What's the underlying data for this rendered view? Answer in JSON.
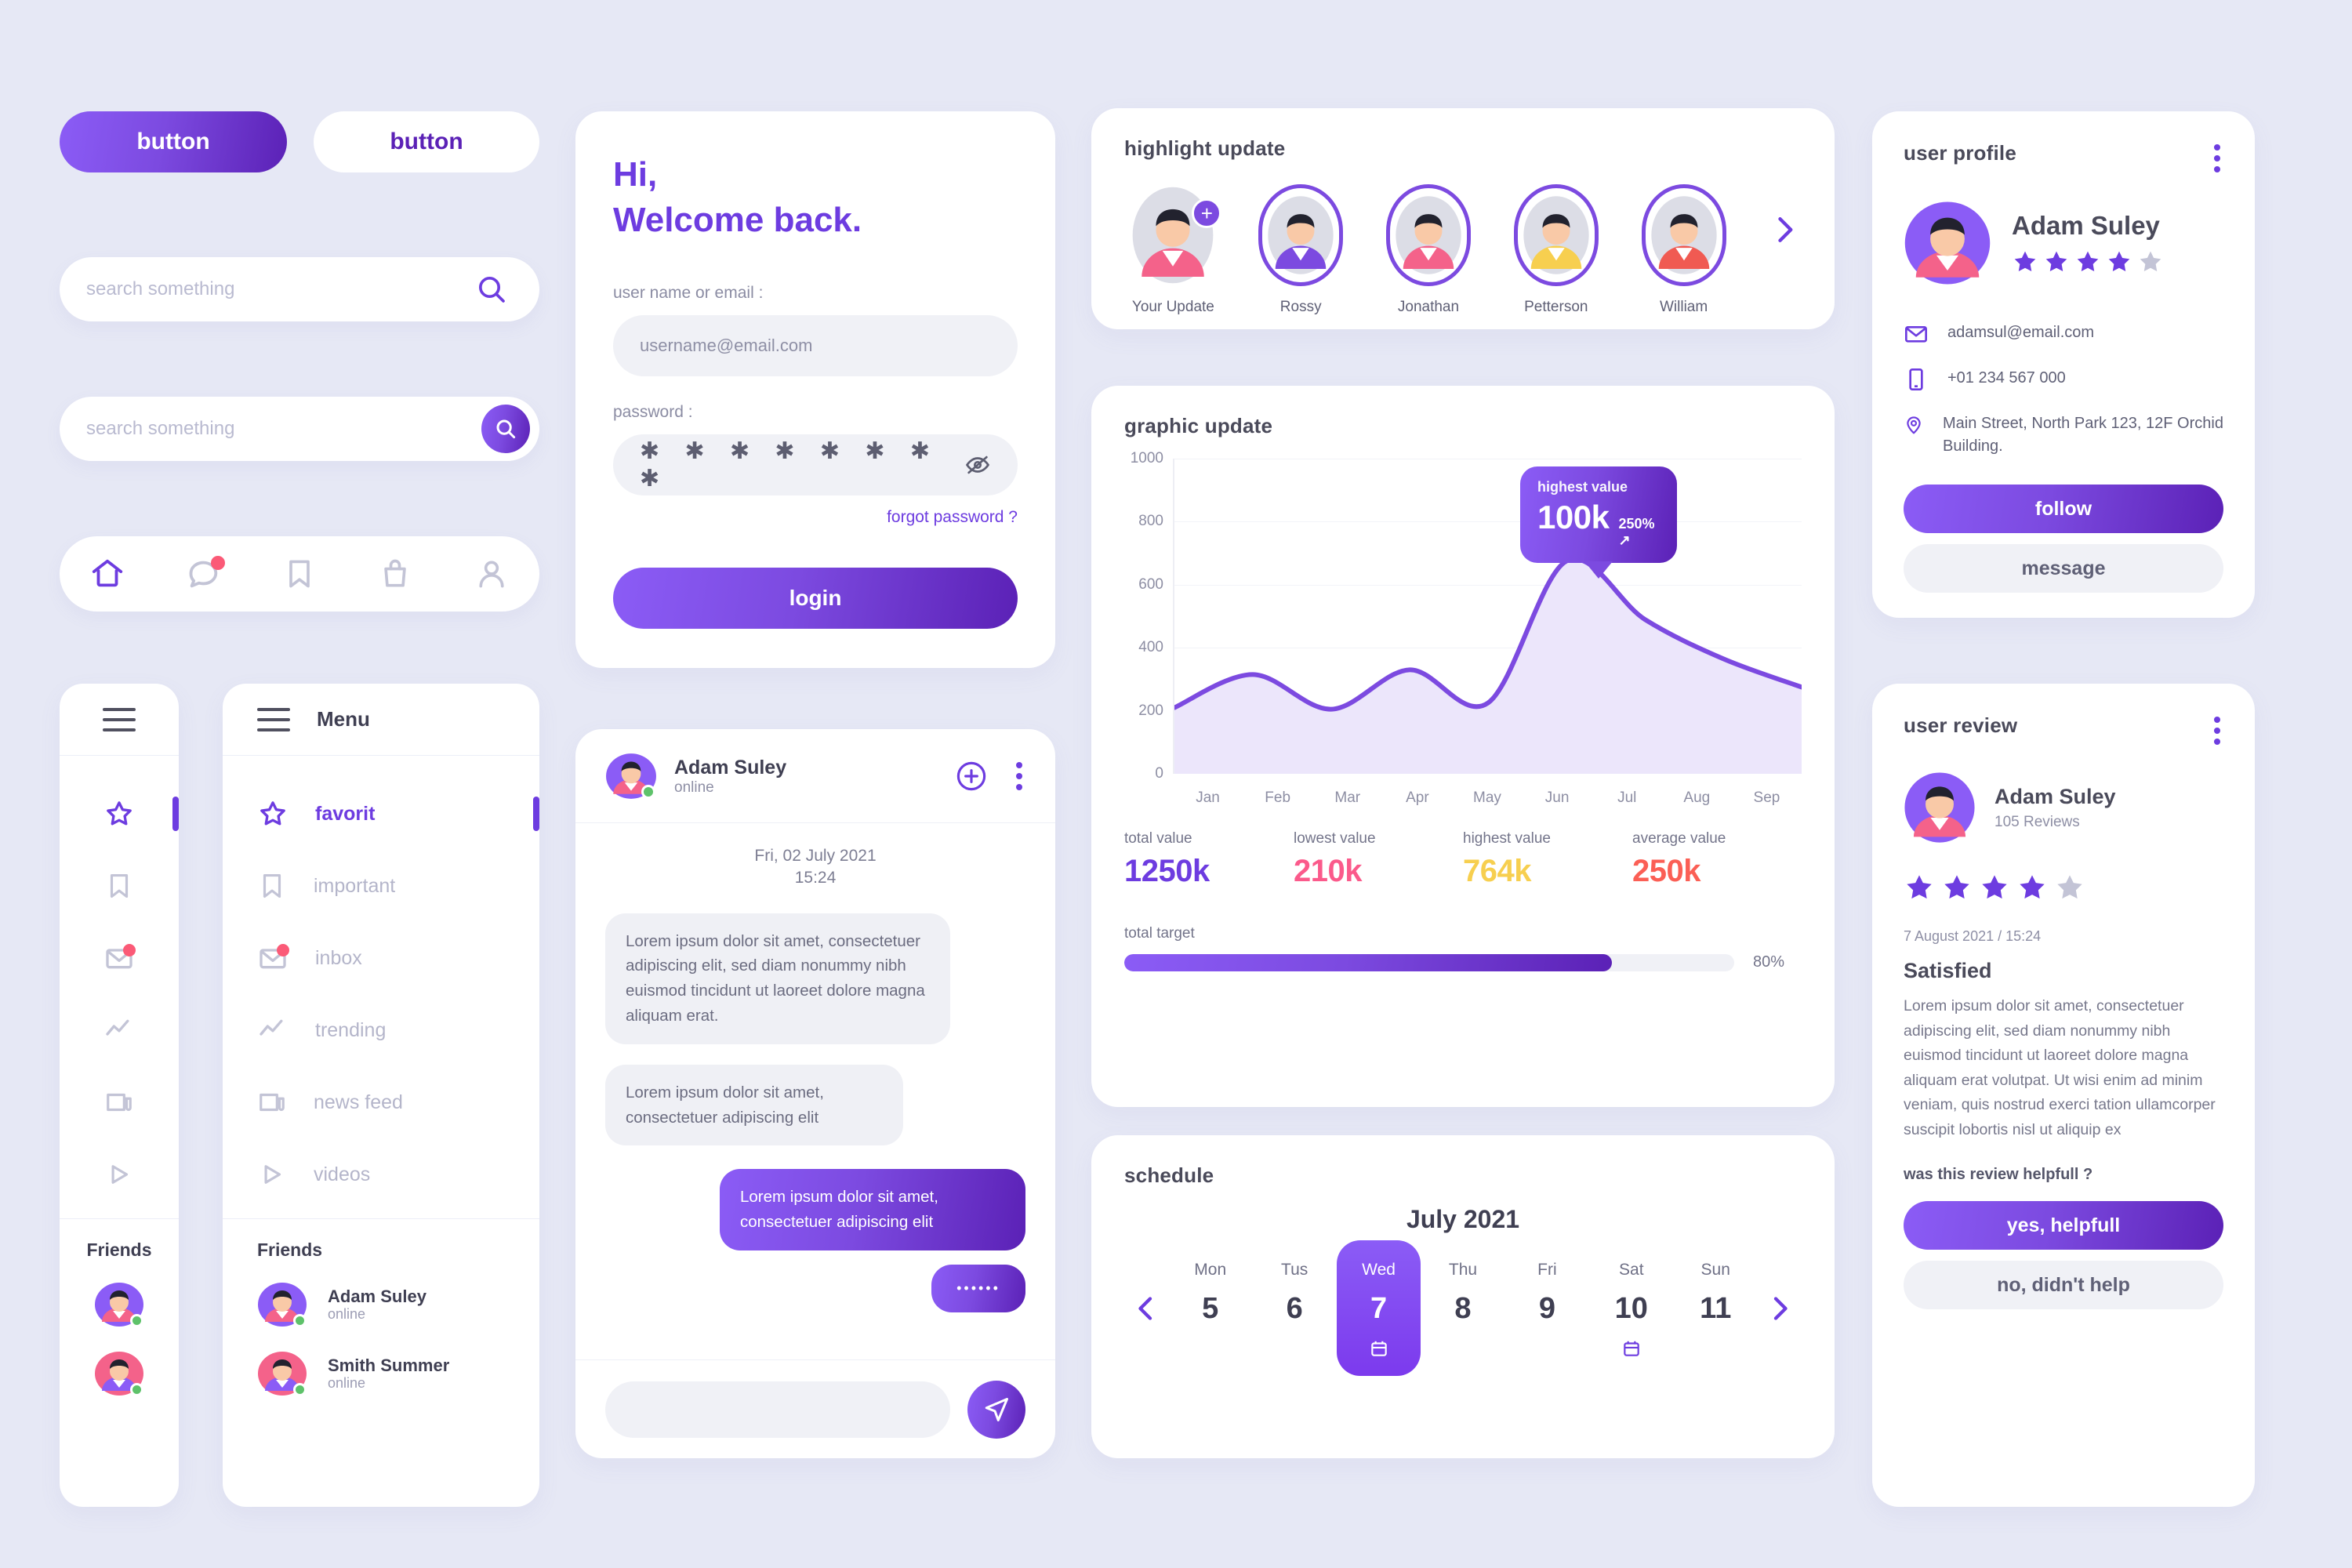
{
  "buttons": {
    "primary_label": "button",
    "secondary_label": "button"
  },
  "search": {
    "plain_placeholder": "search something",
    "round_placeholder": "search something",
    "icon": "search-icon"
  },
  "bottom_nav": {
    "items": [
      {
        "name": "home-icon",
        "active": true,
        "badge": false
      },
      {
        "name": "chat-icon",
        "active": false,
        "badge": true
      },
      {
        "name": "bookmark-icon",
        "active": false,
        "badge": false
      },
      {
        "name": "bag-icon",
        "active": false,
        "badge": false
      },
      {
        "name": "user-icon",
        "active": false,
        "badge": false
      }
    ]
  },
  "sidebar": {
    "title": "Menu",
    "items": [
      {
        "label": "favorit",
        "icon": "star-icon",
        "active": true,
        "badge": false
      },
      {
        "label": "important",
        "icon": "bookmark-icon",
        "active": false,
        "badge": false
      },
      {
        "label": "inbox",
        "icon": "mail-icon",
        "active": false,
        "badge": true
      },
      {
        "label": "trending",
        "icon": "trending-icon",
        "active": false,
        "badge": false
      },
      {
        "label": "news feed",
        "icon": "news-icon",
        "active": false,
        "badge": false
      },
      {
        "label": "videos",
        "icon": "play-icon",
        "active": false,
        "badge": false
      }
    ],
    "friends_title": "Friends",
    "friends": [
      {
        "name": "Adam Suley",
        "status": "online",
        "color": "#8b5cf6"
      },
      {
        "name": "Smith Summer",
        "status": "online",
        "color": "#f4628a"
      }
    ]
  },
  "login": {
    "greeting_line1": "Hi,",
    "greeting_line2": "Welcome back.",
    "username_label": "user name or email :",
    "username_placeholder": "username@email.com",
    "password_label": "password :",
    "password_mask": "✱ ✱ ✱ ✱ ✱ ✱ ✱ ✱",
    "toggle_icon": "eye-off-icon",
    "forgot_label": "forgot password ?",
    "login_label": "login"
  },
  "chat": {
    "contact_name": "Adam Suley",
    "contact_status": "online",
    "add_icon": "plus-circle-icon",
    "menu_icon": "kebab-icon",
    "date_line1": "Fri, 02 July 2021",
    "date_line2": "15:24",
    "messages": [
      {
        "side": "in",
        "text": "Lorem ipsum dolor sit amet, consectetuer adipiscing elit, sed diam nonummy nibh euismod tincidunt ut laoreet dolore magna aliquam erat."
      },
      {
        "side": "in",
        "text": "Lorem ipsum dolor sit amet, consectetuer adipiscing elit"
      },
      {
        "side": "out",
        "text": "Lorem ipsum dolor sit amet, consectetuer adipiscing elit"
      },
      {
        "side": "typing",
        "text": "••••••"
      }
    ],
    "input_placeholder": "",
    "send_icon": "send-icon"
  },
  "highlight": {
    "title": "highlight update",
    "next_icon": "chevron-right-icon",
    "stories": [
      {
        "label": "Your Update",
        "ringed": false,
        "plus": true,
        "shirt": "#f4628a"
      },
      {
        "label": "Rossy",
        "ringed": true,
        "plus": false,
        "shirt": "#7c4ae0"
      },
      {
        "label": "Jonathan",
        "ringed": true,
        "plus": false,
        "shirt": "#f4628a"
      },
      {
        "label": "Petterson",
        "ringed": true,
        "plus": false,
        "shirt": "#f7cf4f"
      },
      {
        "label": "William",
        "ringed": true,
        "plus": false,
        "shirt": "#f05a52"
      }
    ]
  },
  "graph": {
    "title": "graphic update",
    "tooltip_label": "highest value",
    "tooltip_value": "100k",
    "tooltip_delta": "250% ↗",
    "stats": [
      {
        "label": "total value",
        "value": "1250k",
        "color": "#6d3ce0"
      },
      {
        "label": "lowest value",
        "value": "210k",
        "color": "#fb5a8b"
      },
      {
        "label": "highest value",
        "value": "764k",
        "color": "#f7cf4f"
      },
      {
        "label": "average value",
        "value": "250k",
        "color": "#fb5f55"
      }
    ],
    "target_label": "total target",
    "target_pct_label": "80%",
    "target_pct": 80
  },
  "chart_data": {
    "type": "area",
    "title": "graphic update",
    "xlabel": "",
    "ylabel": "",
    "x": [
      "Jan",
      "Feb",
      "Mar",
      "Apr",
      "May",
      "Jun",
      "Jul",
      "Aug",
      "Sep"
    ],
    "values": [
      210,
      315,
      205,
      330,
      225,
      675,
      490,
      365,
      275
    ],
    "ylim": [
      0,
      1000
    ],
    "yticks": [
      0,
      200,
      400,
      600,
      800,
      1000
    ],
    "grid": true,
    "legend": "none",
    "annotations": [
      {
        "at": "Jun",
        "label": "highest value",
        "value": "100k",
        "delta": "250% ↗"
      }
    ],
    "line_color": "#7c4ae0",
    "fill_color": "#ece6fb"
  },
  "schedule": {
    "title": "schedule",
    "month": "July 2021",
    "prev_icon": "chevron-left-icon",
    "next_icon": "chevron-right-icon",
    "days": [
      {
        "name": "Mon",
        "num": "5",
        "selected": false,
        "event": false
      },
      {
        "name": "Tus",
        "num": "6",
        "selected": false,
        "event": false
      },
      {
        "name": "Wed",
        "num": "7",
        "selected": true,
        "event": true
      },
      {
        "name": "Thu",
        "num": "8",
        "selected": false,
        "event": false
      },
      {
        "name": "Fri",
        "num": "9",
        "selected": false,
        "event": false
      },
      {
        "name": "Sat",
        "num": "10",
        "selected": false,
        "event": true
      },
      {
        "name": "Sun",
        "num": "11",
        "selected": false,
        "event": false
      }
    ]
  },
  "profile": {
    "title": "user profile",
    "name": "Adam Suley",
    "rating": 4,
    "rating_max": 5,
    "email": "adamsul@email.com",
    "phone": "+01 234 567 000",
    "address": "Main Street, North Park 123, 12F Orchid Building.",
    "email_icon": "mail-icon",
    "phone_icon": "phone-icon",
    "address_icon": "location-pin-icon",
    "follow_label": "follow",
    "message_label": "message"
  },
  "review": {
    "title": "user review",
    "name": "Adam Suley",
    "reviews_count": "105 Reviews",
    "rating": 4,
    "rating_max": 5,
    "date": "7 August 2021 / 15:24",
    "headline": "Satisfied",
    "body": "Lorem ipsum dolor sit amet, consectetuer adipiscing elit, sed diam nonummy nibh euismod tincidunt ut laoreet dolore magna aliquam erat volutpat. Ut wisi enim ad minim veniam, quis nostrud exerci tation ullamcorper suscipit lobortis nisl ut aliquip ex",
    "question": "was this review helpfull ?",
    "yes_label": "yes, helpfull",
    "no_label": "no, didn't help"
  },
  "colors": {
    "background": "#e6e8f5",
    "accent": "#7c4ae0",
    "accent_dark": "#5b21b6",
    "muted": "#b4b5ca",
    "badge": "#fb5a77",
    "online": "#5ec26a"
  }
}
